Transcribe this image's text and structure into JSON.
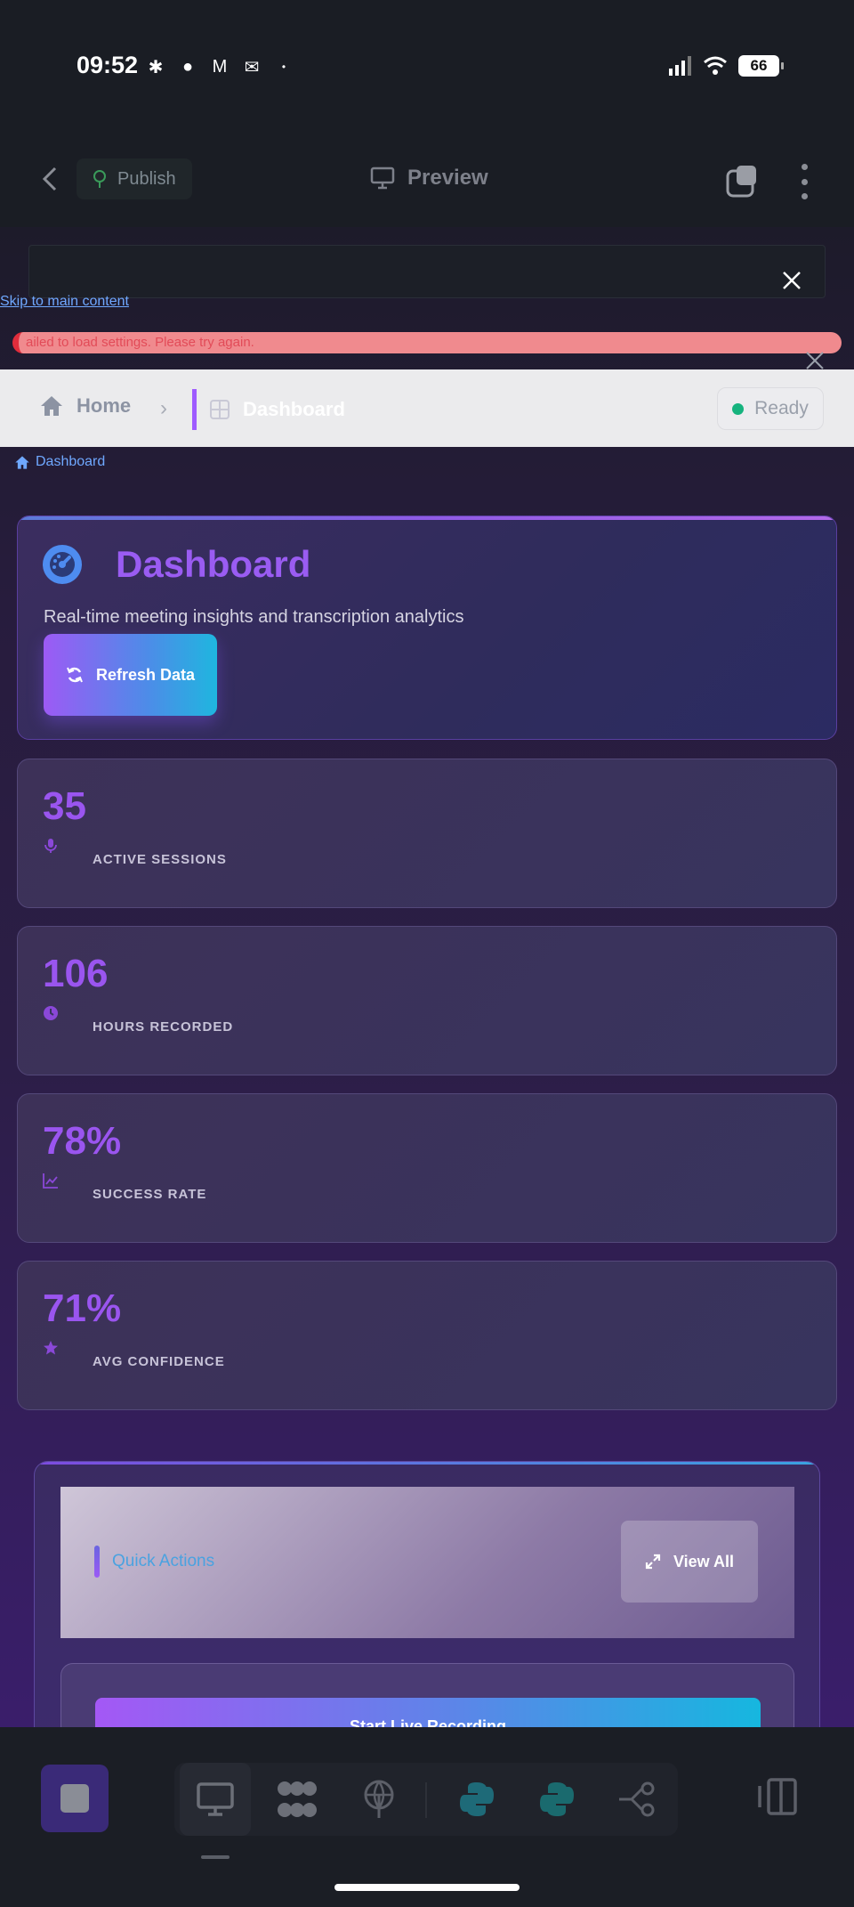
{
  "status_bar": {
    "time": "09:52",
    "battery": "66",
    "notification_icons": [
      "slack-icon",
      "chat-icon",
      "gmail-icon",
      "mail-icon",
      "dot-icon"
    ],
    "system_icons": [
      "signal-icon",
      "wifi-icon",
      "battery-icon"
    ]
  },
  "app_bar": {
    "publish_label": "Publish",
    "preview_label": "Preview"
  },
  "web": {
    "skip_link": "Skip to main content",
    "error_text": "ailed to load settings. Please try again.",
    "breadcrumb": {
      "home": "Home",
      "current": "Dashboard",
      "status": "Ready"
    },
    "page_crumb": "Dashboard",
    "hero": {
      "title": "Dashboard",
      "subtitle": "Real-time meeting insights and transcription analytics",
      "refresh_label": "Refresh Data"
    },
    "stats": [
      {
        "value": "35",
        "label": "ACTIVE SESSIONS",
        "icon": "microphone-icon"
      },
      {
        "value": "106",
        "label": "HOURS RECORDED",
        "icon": "clock-icon"
      },
      {
        "value": "78%",
        "label": "SUCCESS RATE",
        "icon": "chart-line-icon"
      },
      {
        "value": "71%",
        "label": "AVG CONFIDENCE",
        "icon": "star-icon"
      }
    ],
    "quick_actions": {
      "title": "Quick Actions",
      "view_all": "View All",
      "live_recording": "Start Live Recording"
    }
  },
  "colors": {
    "accent_purple": "#9a55ef",
    "error_red": "#e02d3c",
    "ready_green": "#16b37e",
    "link_blue": "#6fa8ff"
  }
}
